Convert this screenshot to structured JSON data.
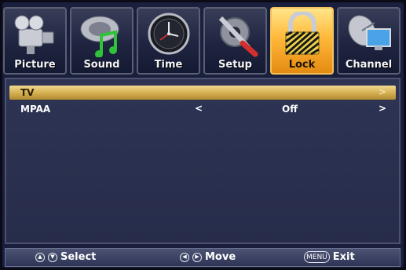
{
  "tabs": [
    {
      "label": "Picture",
      "icon": "camcorder-icon",
      "active": false
    },
    {
      "label": "Sound",
      "icon": "music-note-icon",
      "active": false
    },
    {
      "label": "Time",
      "icon": "clock-icon",
      "active": false
    },
    {
      "label": "Setup",
      "icon": "tools-icon",
      "active": false
    },
    {
      "label": "Lock",
      "icon": "padlock-icon",
      "active": true
    },
    {
      "label": "Channel",
      "icon": "satellite-dish-icon",
      "active": false
    }
  ],
  "menu": {
    "rows": [
      {
        "label": "TV",
        "value": "",
        "selected": true
      },
      {
        "label": "MPAA",
        "value": "Off",
        "selected": false
      }
    ],
    "left_arrow": "<",
    "right_arrow": ">"
  },
  "help": {
    "select": "Select",
    "move": "Move",
    "menu_key": "MENU",
    "exit": "Exit"
  },
  "colors": {
    "background": "#1a1f3e",
    "selection": "#d6b255",
    "active_tab": "#ffb93a"
  }
}
